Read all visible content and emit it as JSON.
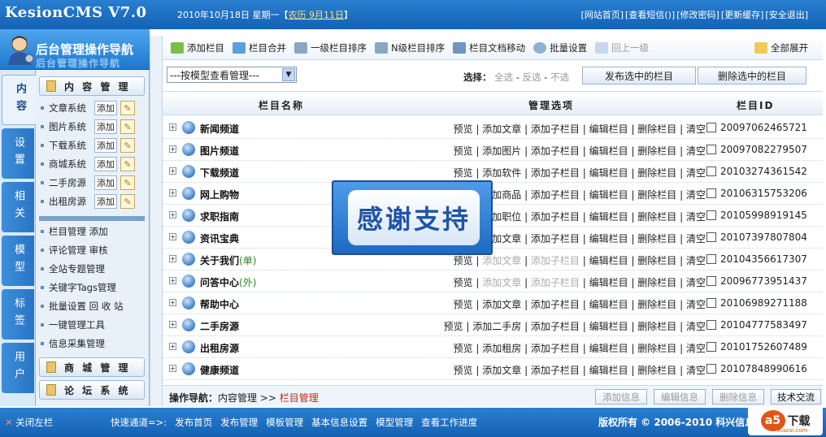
{
  "app": {
    "logo": "KesionCMS V7.0"
  },
  "header": {
    "date": "2010年10月18日 星期一【",
    "lunar": "农历 9月11日",
    "date_end": "】",
    "links": [
      "[网站首页]",
      "[查看短信()]",
      "[修改密码]",
      "[更新缓存]",
      "[安全退出]"
    ]
  },
  "nav": {
    "title": "后台管理操作导航",
    "title_shadow": "后台管理操作导航"
  },
  "vtabs": [
    "内容",
    "设置",
    "相关",
    "模型",
    "标签",
    "用户"
  ],
  "side": {
    "section_content": "内 容 管 理",
    "modules": [
      {
        "name": "文章系统",
        "add": "添加"
      },
      {
        "name": "图片系统",
        "add": "添加"
      },
      {
        "name": "下载系统",
        "add": "添加"
      },
      {
        "name": "商城系统",
        "add": "添加"
      },
      {
        "name": "二手房源",
        "add": "添加"
      },
      {
        "name": "出租房源",
        "add": "添加"
      }
    ],
    "links": [
      "栏目管理 添加",
      "评论管理 审核",
      "全站专题管理",
      "关键字Tags管理",
      "批量设置 回 收 站",
      "一键管理工具",
      "信息采集管理"
    ],
    "section_mall": "商 城 管 理",
    "section_forum": "论 坛 系 统"
  },
  "toolbar": {
    "add_column": "添加栏目",
    "merge": "栏目合并",
    "sort1": "一级栏目排序",
    "sortn": "N级栏目排序",
    "move": "栏目文档移动",
    "batch": "批量设置",
    "up": "回上一级",
    "expand": "全部展开"
  },
  "filter": {
    "select_value": "---按模型查看管理---",
    "choose_label": "选择：",
    "all": "全选",
    "inverse": "反选",
    "none": "不选",
    "publish_btn": "发布选中的栏目",
    "delete_btn": "删除选中的栏目"
  },
  "table": {
    "headers": {
      "name": "栏目名称",
      "ops": "管理选项",
      "id": "栏目ID"
    },
    "rows": [
      {
        "name": "新闻频道",
        "tag": "",
        "ops": [
          "预览",
          "添加文章",
          "添加子栏目",
          "编辑栏目",
          "删除栏目",
          "清空"
        ],
        "dis": [],
        "id": "20097062465721"
      },
      {
        "name": "图片频道",
        "tag": "",
        "ops": [
          "预览",
          "添加图片",
          "添加子栏目",
          "编辑栏目",
          "删除栏目",
          "清空"
        ],
        "dis": [],
        "id": "20097082279507"
      },
      {
        "name": "下载频道",
        "tag": "",
        "ops": [
          "预览",
          "添加软件",
          "添加子栏目",
          "编辑栏目",
          "删除栏目",
          "清空"
        ],
        "dis": [],
        "id": "20103274361542"
      },
      {
        "name": "网上购物",
        "tag": "",
        "ops": [
          "预览",
          "添加商品",
          "添加子栏目",
          "编辑栏目",
          "删除栏目",
          "清空"
        ],
        "dis": [],
        "id": "20106315753206"
      },
      {
        "name": "求职指南",
        "tag": "",
        "ops": [
          "预览",
          "添加职位",
          "添加子栏目",
          "编辑栏目",
          "删除栏目",
          "清空"
        ],
        "dis": [],
        "id": "20105998919145"
      },
      {
        "name": "资讯宝典",
        "tag": "",
        "ops": [
          "预览",
          "添加文章",
          "添加子栏目",
          "编辑栏目",
          "删除栏目",
          "清空"
        ],
        "dis": [],
        "id": "20107397807804"
      },
      {
        "name": "关于我们",
        "tag": "(单)",
        "ops": [
          "预览",
          "添加文章",
          "添加子栏目",
          "编辑栏目",
          "删除栏目",
          "清空"
        ],
        "dis": [
          1,
          2
        ],
        "id": "20104356617307"
      },
      {
        "name": "问答中心",
        "tag": "(外)",
        "ops": [
          "预览",
          "添加文章",
          "添加子栏目",
          "编辑栏目",
          "删除栏目",
          "清空"
        ],
        "dis": [
          1,
          2
        ],
        "id": "20096773951437"
      },
      {
        "name": "帮助中心",
        "tag": "",
        "ops": [
          "预览",
          "添加文章",
          "添加子栏目",
          "编辑栏目",
          "删除栏目",
          "清空"
        ],
        "dis": [],
        "id": "20106989271188"
      },
      {
        "name": "二手房源",
        "tag": "",
        "ops": [
          "预览",
          "添加二手房",
          "添加子栏目",
          "编辑栏目",
          "删除栏目",
          "清空"
        ],
        "dis": [],
        "id": "20104777583497"
      },
      {
        "name": "出租房源",
        "tag": "",
        "ops": [
          "预览",
          "添加租房",
          "添加子栏目",
          "编辑栏目",
          "删除栏目",
          "清空"
        ],
        "dis": [],
        "id": "20101752607489"
      },
      {
        "name": "健康频道",
        "tag": "",
        "ops": [
          "预览",
          "添加文章",
          "添加子栏目",
          "编辑栏目",
          "删除栏目",
          "清空"
        ],
        "dis": [],
        "id": "20107848990616"
      }
    ]
  },
  "status": {
    "crumb_label": "操作导航：",
    "crumb_path": "内容管理 >> ",
    "crumb_current": "栏目管理",
    "btn_add": "添加信息",
    "btn_edit": "编辑信息",
    "btn_delete": "删除信息",
    "btn_support": "技术交流"
  },
  "overlay": {
    "text": "感谢支持"
  },
  "footer": {
    "close": "关闭左栏",
    "quick_label": "快速通道=>:",
    "quick": [
      "发布首页",
      "发布管理",
      "模板管理",
      "基本信息设置",
      "模型管理",
      "查看工作进度"
    ],
    "copyright": "版权所有 © 2006-2010 科兴信息"
  },
  "watermark": {
    "a5": "a5",
    "text": "下载",
    "url": "xiazai.com"
  }
}
